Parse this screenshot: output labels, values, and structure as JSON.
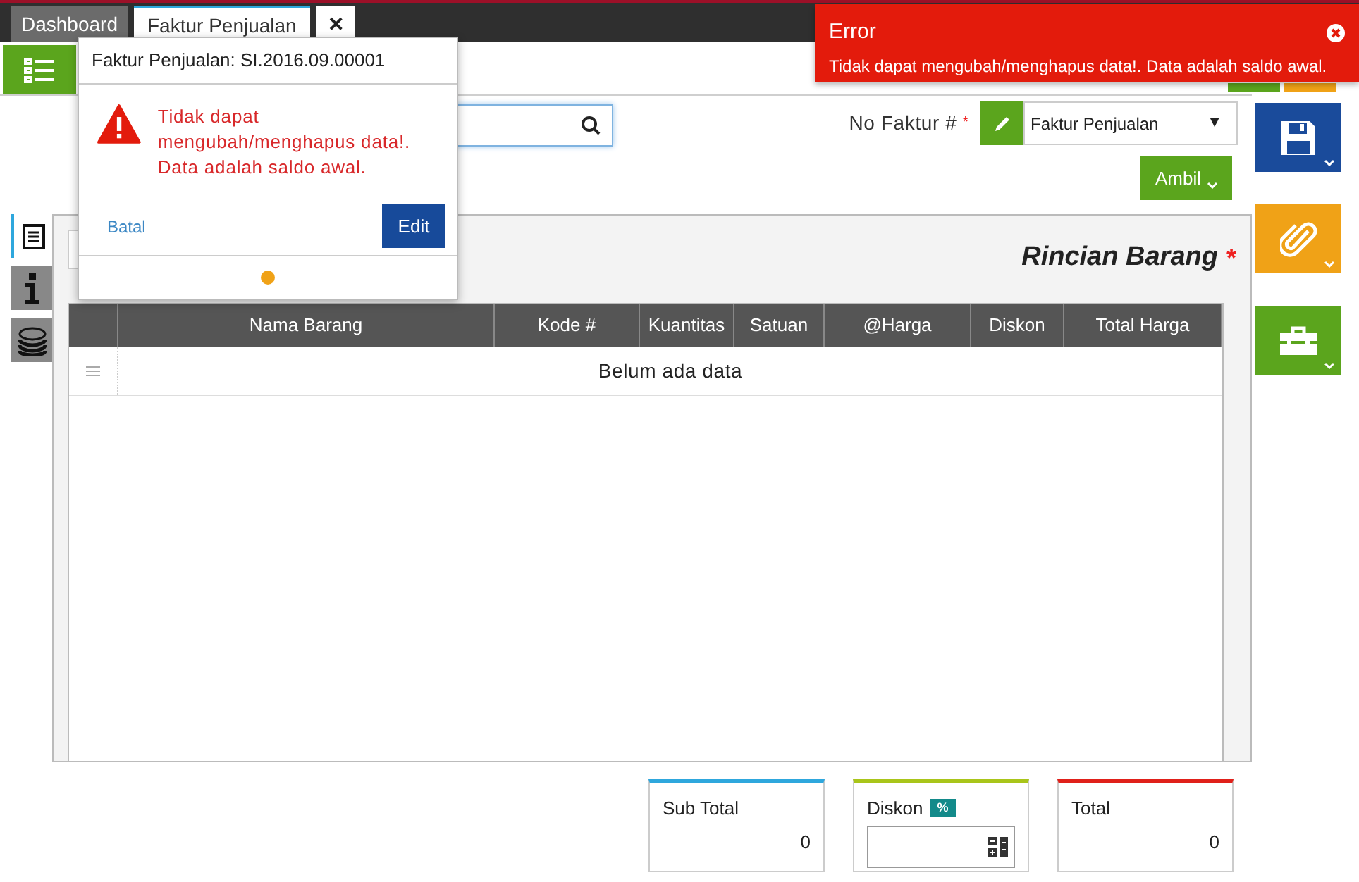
{
  "tabs": [
    {
      "label": "Dashboard",
      "selected": false
    },
    {
      "label": "Faktur Penjualan",
      "selected": true
    }
  ],
  "tab_close": "✕",
  "form": {
    "invoice_label": "No Faktur #",
    "required_mark": "*",
    "invoice_type": "Faktur Penjualan",
    "select_caret": "▼",
    "fetch_button": "Ambil"
  },
  "side_tabs": [
    {
      "kind": "list",
      "selected": true
    },
    {
      "kind": "info",
      "selected": false
    },
    {
      "kind": "money",
      "selected": false
    }
  ],
  "panel": {
    "title": "Rincian Barang",
    "required_mark": "*"
  },
  "table": {
    "columns": [
      "Nama Barang",
      "Kode #",
      "Kuantitas",
      "Satuan",
      "@Harga",
      "Diskon",
      "Total Harga"
    ],
    "empty_text": "Belum ada data"
  },
  "summary": [
    {
      "kind": "value",
      "label": "Sub Total",
      "value": "0",
      "color": "#2ea7dd"
    },
    {
      "kind": "input",
      "label": "Diskon",
      "badge": "%",
      "color": "#a9c51a"
    },
    {
      "kind": "value",
      "label": "Total",
      "value": "0",
      "color": "#e0201a"
    }
  ],
  "popover": {
    "title": "Faktur Penjualan: SI.2016.09.00001",
    "message": "Tidak dapat mengubah/menghapus data!. Data adalah saldo awal.",
    "cancel": "Batal",
    "confirm": "Edit"
  },
  "toast": {
    "title": "Error",
    "message": "Tidak dapat mengubah/menghapus data!. Data adalah saldo awal."
  }
}
